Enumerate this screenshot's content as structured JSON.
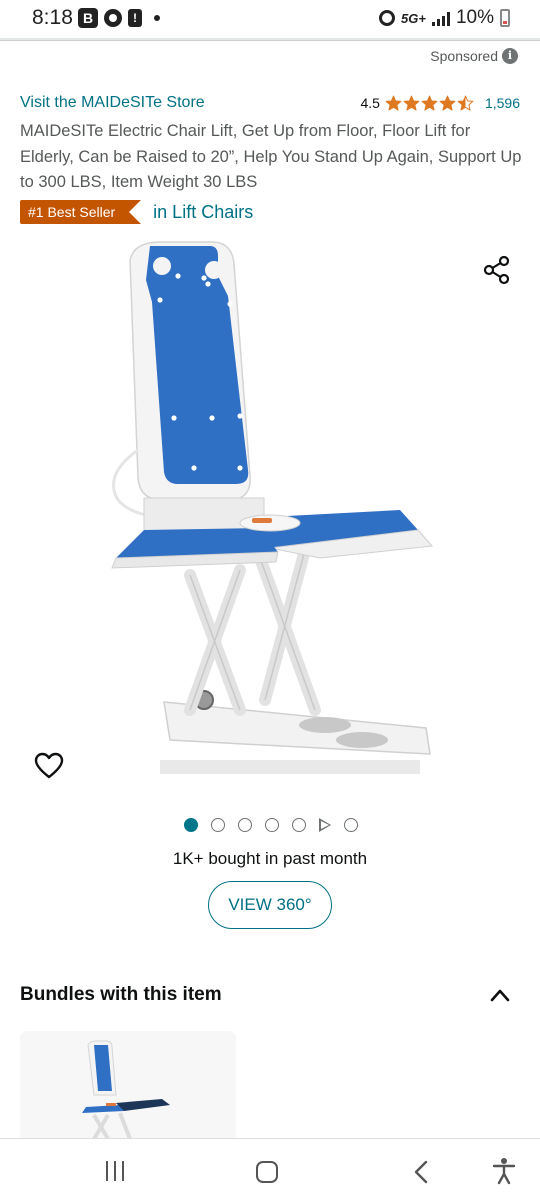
{
  "status_bar": {
    "time": "8:18",
    "badge_letter": "B",
    "alert_glyph": "!",
    "network": "5G+",
    "battery": "10%",
    "battery_level": 0.1,
    "icons": [
      "b-badge-icon",
      "settings-icon",
      "alert-icon",
      "dot-icon",
      "alarm-icon",
      "signal-icon",
      "battery-icon"
    ]
  },
  "ad": {
    "sponsored_label": "Sponsored",
    "info_glyph": "i"
  },
  "product": {
    "store_link": "Visit the MAIDeSITe Store",
    "rating_value": "4.5",
    "rating_stars": 4.5,
    "rating_count": "1,596",
    "title": "MAIDeSITe Electric Chair Lift, Get Up from Floor, Floor Lift for Elderly, Can be Raised to 20”, Help You Stand Up Again, Support Up to 300 LBS, Item Weight 30 LBS",
    "best_seller_badge": "#1 Best Seller",
    "best_seller_category": "in Lift Chairs",
    "bought_text": "1K+ bought in past month",
    "view360_label": "VIEW 360°"
  },
  "carousel": {
    "total_dots": 6,
    "active_index": 0,
    "video_index": 5
  },
  "bundles": {
    "title": "Bundles with this item"
  },
  "colors": {
    "link": "#007185",
    "star": "#de7921",
    "badge": "#c45500",
    "active_dot": "#00768b",
    "seat_blue": "#2f6fc4"
  }
}
